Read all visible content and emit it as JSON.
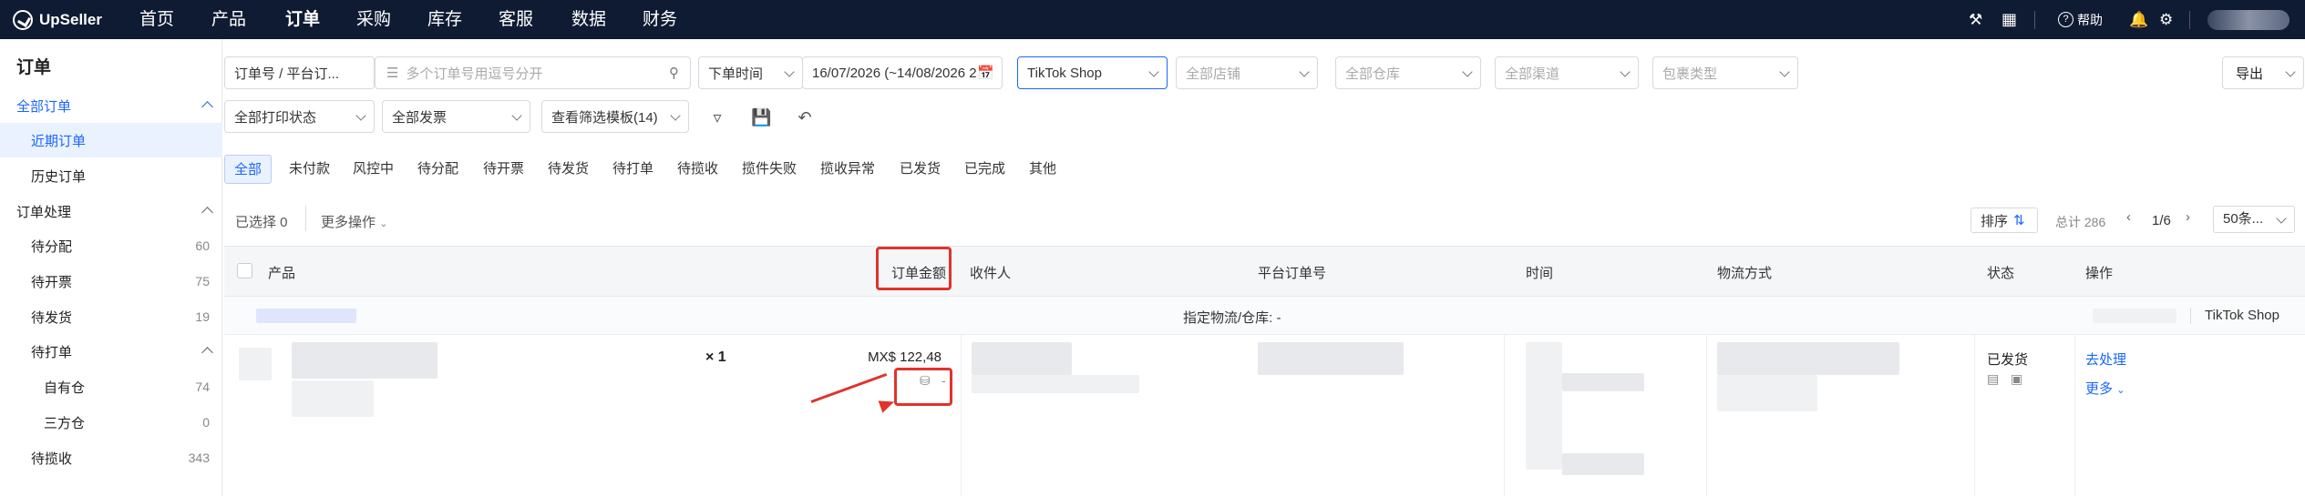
{
  "app": {
    "logo_text": "UpSeller"
  },
  "nav": {
    "items": [
      "首页",
      "产品",
      "订单",
      "采购",
      "库存",
      "客服",
      "数据",
      "财务"
    ],
    "help_label": "帮助"
  },
  "sidebar": {
    "title": "订单",
    "items": [
      {
        "label": "全部订单",
        "count": ""
      },
      {
        "label": "近期订单",
        "count": ""
      },
      {
        "label": "历史订单",
        "count": ""
      },
      {
        "label": "订单处理",
        "count": ""
      },
      {
        "label": "待分配",
        "count": "60"
      },
      {
        "label": "待开票",
        "count": "75"
      },
      {
        "label": "待发货",
        "count": "19"
      },
      {
        "label": "待打单",
        "count": ""
      },
      {
        "label": "自有仓",
        "count": "74"
      },
      {
        "label": "三方仓",
        "count": "0"
      },
      {
        "label": "待揽收",
        "count": "343"
      }
    ]
  },
  "filters": {
    "search_type": "订单号 / 平台订...",
    "search_placeholder": "多个订单号用逗号分开",
    "time_type": "下单时间",
    "date_range": "16/07/2026 (~14/08/2026 2",
    "platform": "TikTok Shop",
    "shop_placeholder": "全部店铺",
    "warehouse_placeholder": "全部仓库",
    "channel_placeholder": "全部渠道",
    "package_placeholder": "包裹类型",
    "print_status": "全部打印状态",
    "invoice": "全部发票",
    "template": "查看筛选模板(14)",
    "export_label": "导出"
  },
  "tabs": [
    "全部",
    "未付款",
    "风控中",
    "待分配",
    "待开票",
    "待发货",
    "待打单",
    "待揽收",
    "揽件失败",
    "揽收异常",
    "已发货",
    "已完成",
    "其他"
  ],
  "toolbar": {
    "selected": "已选择 0",
    "more_ops": "更多操作",
    "sort_label": "排序",
    "total": "总计 286",
    "page": "1/6",
    "page_size": "50条..."
  },
  "table": {
    "headers": [
      "产品",
      "订单金额",
      "收件人",
      "平台订单号",
      "时间",
      "物流方式",
      "状态",
      "操作"
    ],
    "group": {
      "logistics": "指定物流/仓库: -",
      "platform": "TikTok Shop"
    },
    "row": {
      "qty": "× 1",
      "amount": "MX$ 122,48",
      "amount_sub": "-",
      "status": "已发货",
      "action_primary": "去处理",
      "action_more": "更多"
    }
  },
  "colors": {
    "accent": "#1a66ff",
    "nav_bg": "#0f1b33",
    "highlight": "#e0332c"
  }
}
